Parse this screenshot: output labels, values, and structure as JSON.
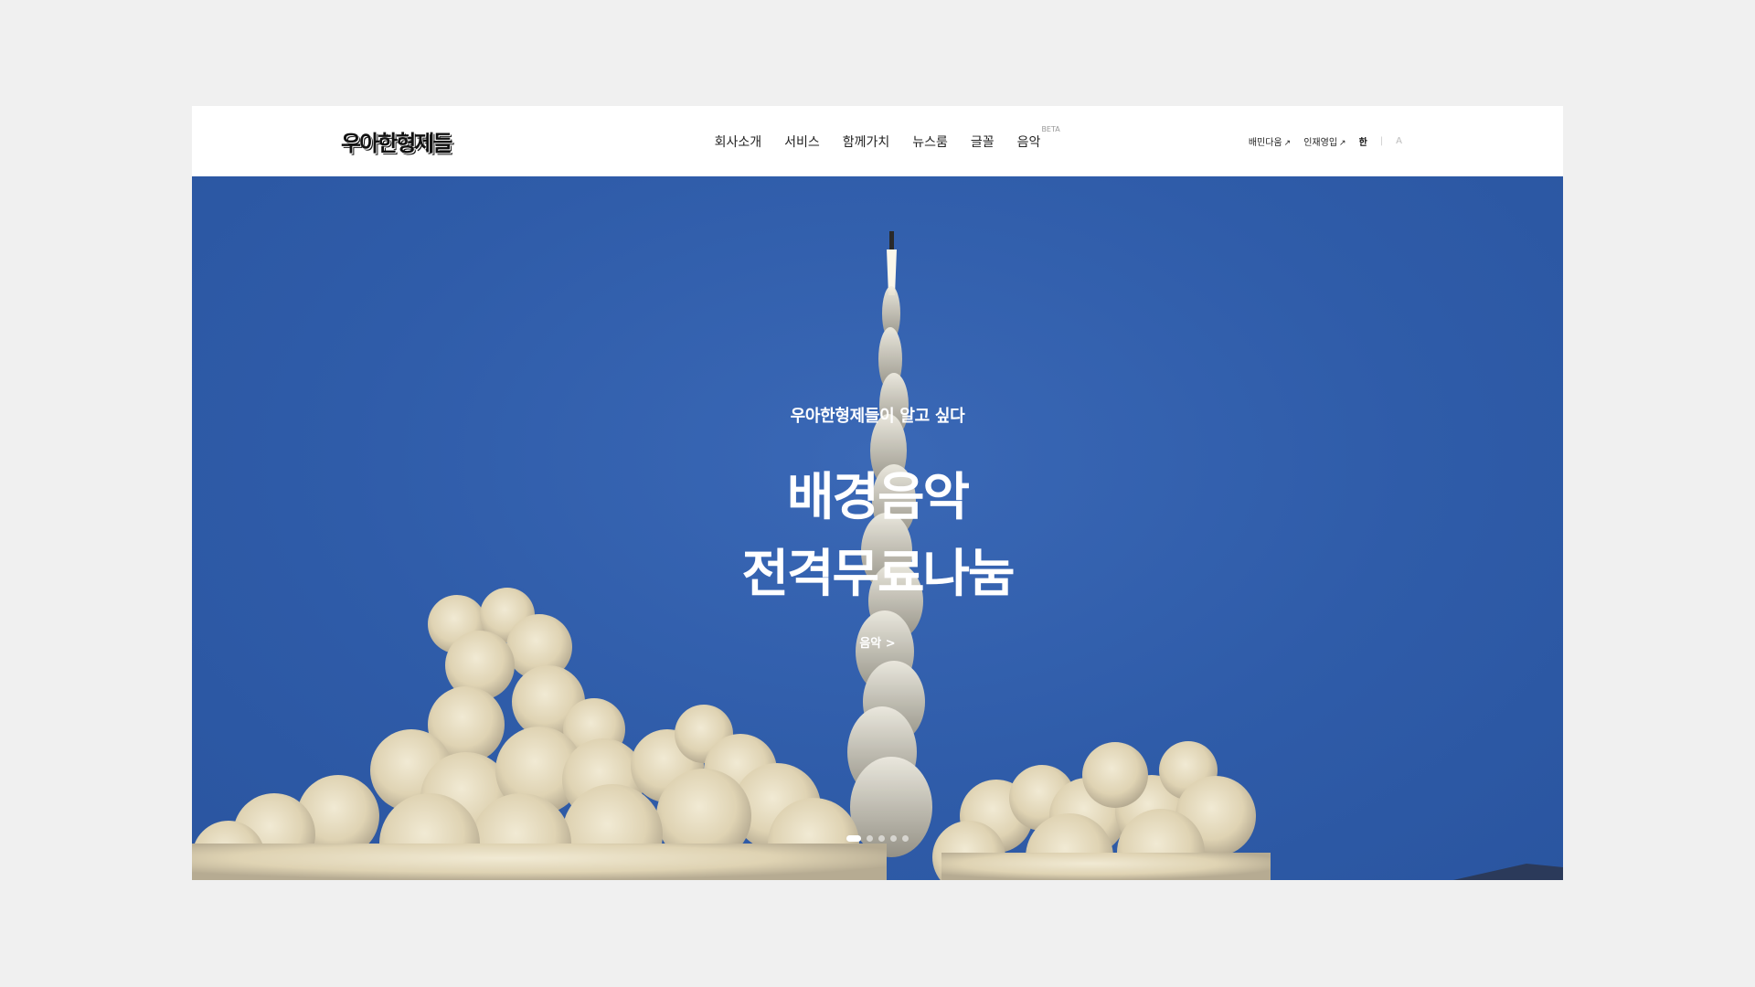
{
  "header": {
    "logo_text": "우아한형제들",
    "nav": [
      {
        "label": "회사소개"
      },
      {
        "label": "서비스"
      },
      {
        "label": "함께가치"
      },
      {
        "label": "뉴스룸"
      },
      {
        "label": "글꼴"
      },
      {
        "label": "음악",
        "badge": "BETA"
      }
    ],
    "util": {
      "link1": "배민다움",
      "link2": "인재영입",
      "arrow": "↗",
      "lang_ko": "한",
      "lang_sep": "|",
      "lang_en": "A"
    }
  },
  "hero": {
    "eyebrow": "우아한형제들이 알고 싶다",
    "headline_line1": "배경음악",
    "headline_line2": "전격무료나눔",
    "cta": "음악 >",
    "slides_total": 5,
    "active_slide": 1,
    "colors": {
      "sky": "#2f5ca9",
      "smoke": "#e6dcc0"
    }
  }
}
